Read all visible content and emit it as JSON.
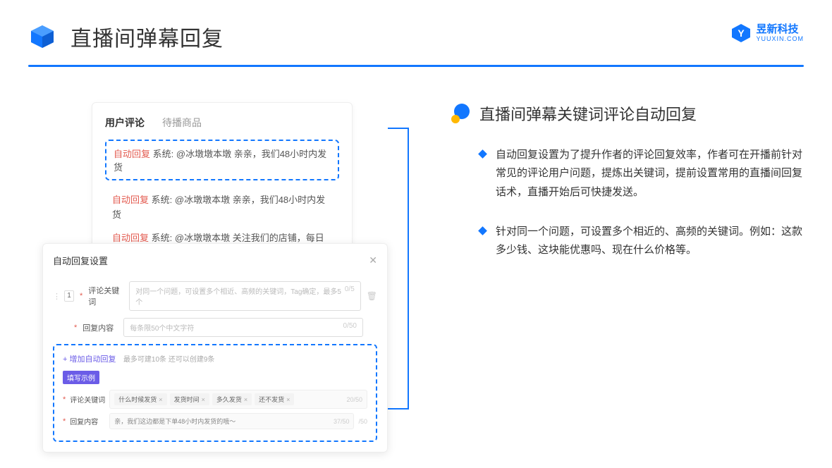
{
  "header": {
    "title": "直播间弹幕回复",
    "brand_cn": "昱新科技",
    "brand_en": "YUUXIN.COM"
  },
  "card1": {
    "tab_active": "用户评论",
    "tab_inactive": "待播商品",
    "auto_label": "自动回复",
    "sys_prefix": "系统:",
    "highlighted": "@冰墩墩本墩 亲亲，我们48小时内发货",
    "line2": "@冰墩墩本墩 亲亲，我们48小时内发货",
    "line3": "@冰墩墩本墩 关注我们的店铺，每日都有热门推荐呦～"
  },
  "card2": {
    "title": "自动回复设置",
    "row_num": "1",
    "field1_label": "评论关键词",
    "field1_placeholder": "对同一个问题，可设置多个相近、高频的关键词，Tag确定，最多5个",
    "field1_count": "0/5",
    "field2_label": "回复内容",
    "field2_placeholder": "每条限50个中文字符",
    "field2_count": "0/50",
    "add_text": "+ 增加自动回复",
    "add_hint": "最多可建10条 还可以创建9条",
    "example_badge": "填写示例",
    "ex_label1": "评论关键词",
    "ex_tags": [
      "什么时候发货",
      "发货时间",
      "多久发货",
      "还不发货"
    ],
    "ex_count1": "20/50",
    "ex_label2": "回复内容",
    "ex_text2": "亲，我们这边都是下单48小时内发货的哦～",
    "ex_count2": "37/50",
    "outer_count": "/50"
  },
  "right": {
    "section_title": "直播间弹幕关键词评论自动回复",
    "bullet1": "自动回复设置为了提升作者的评论回复效率，作者可在开播前针对常见的评论用户问题，提炼出关键词，提前设置常用的直播间回复话术，直播开始后可快捷发送。",
    "bullet2": "针对同一个问题，可设置多个相近的、高频的关键词。例如：这款多少钱、这块能优惠吗、现在什么价格等。"
  }
}
